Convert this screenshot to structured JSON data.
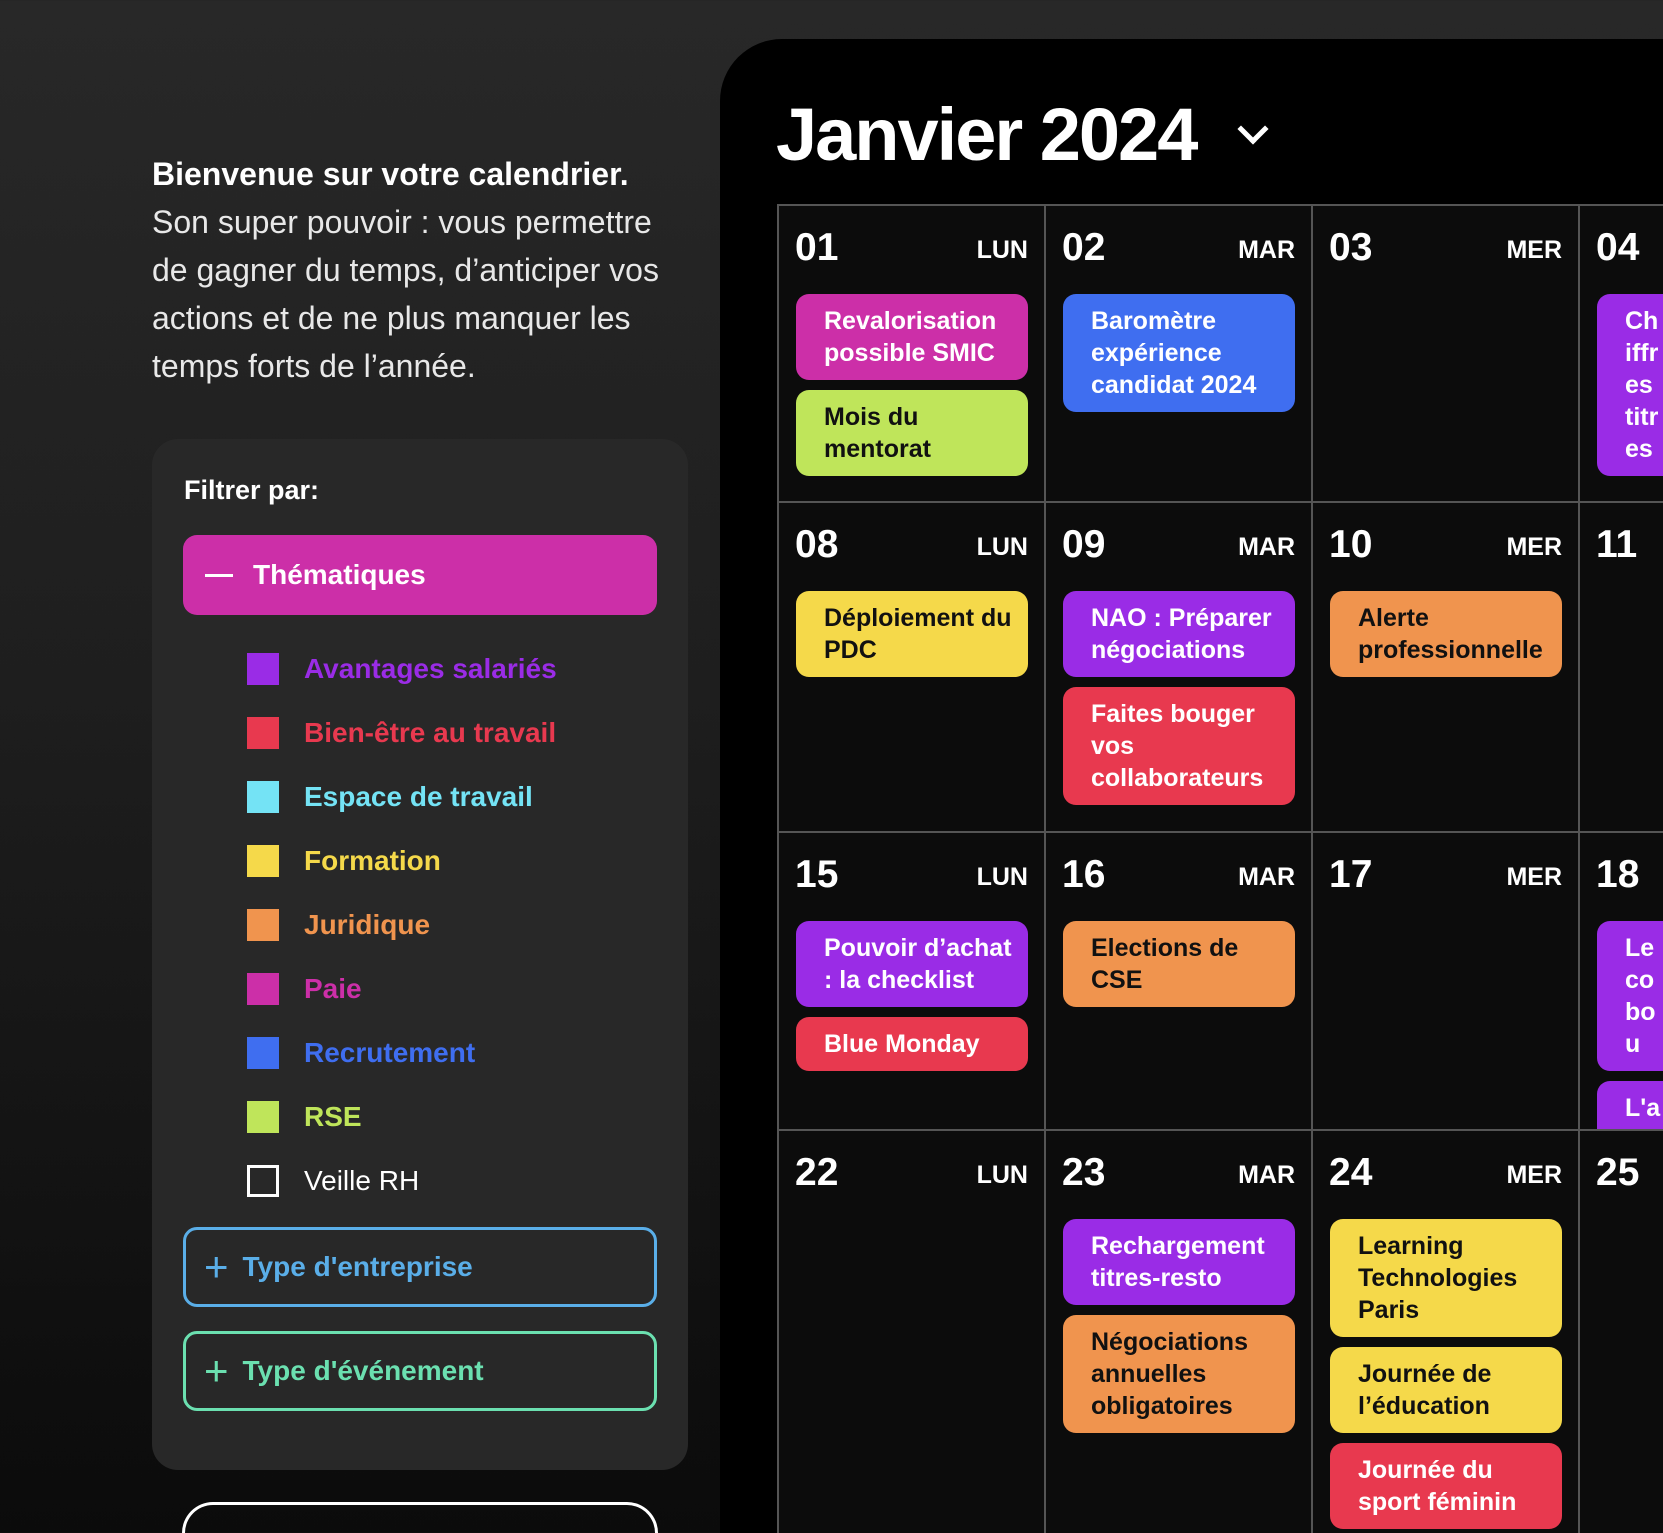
{
  "intro": {
    "title": "Bienvenue sur votre calendrier.",
    "text": "Son super pouvoir : vous permettre de gagner du temps, d’anticiper vos actions et de ne plus manquer les temps forts de l’année."
  },
  "filter": {
    "title": "Filtrer par:",
    "thematiques": "Thématiques",
    "categories": [
      {
        "label": "Avantages salariés",
        "color": "#9a2ce6"
      },
      {
        "label": "Bien-être au travail",
        "color": "#e8394f"
      },
      {
        "label": "Espace de travail",
        "color": "#74e3f5"
      },
      {
        "label": "Formation",
        "color": "#f5d94a"
      },
      {
        "label": "Juridique",
        "color": "#f0944e"
      },
      {
        "label": "Paie",
        "color": "#cc2fa8"
      },
      {
        "label": "Recrutement",
        "color": "#3f6ef0"
      },
      {
        "label": "RSE",
        "color": "#bfe55a"
      },
      {
        "label": "Veille RH",
        "color": "outline"
      }
    ],
    "type_entreprise": "Type d'entreprise",
    "type_evenement": "Type d'événement"
  },
  "calendar": {
    "month": "Janvier 2024",
    "weeks": [
      [
        {
          "day": "01",
          "label": "LUN",
          "events": [
            {
              "t": "Revalorisation possible SMIC",
              "c": "#cc2fa8"
            },
            {
              "t": "Mois du mentorat",
              "c": "#bfe55a",
              "dark": true
            }
          ]
        },
        {
          "day": "02",
          "label": "MAR",
          "events": [
            {
              "t": "Baromètre expérience candidat 2024",
              "c": "#3f6ef0"
            }
          ]
        },
        {
          "day": "03",
          "label": "MER",
          "events": []
        },
        {
          "day": "04",
          "label": "",
          "events": [
            {
              "t": "Chiffres titres",
              "c": "#9a2ce6"
            }
          ]
        }
      ],
      [
        {
          "day": "08",
          "label": "LUN",
          "events": [
            {
              "t": "Déploiement du PDC",
              "c": "#f5d94a",
              "dark": true
            }
          ]
        },
        {
          "day": "09",
          "label": "MAR",
          "events": [
            {
              "t": "NAO : Préparer négociations",
              "c": "#9a2ce6"
            },
            {
              "t": "Faites bouger vos collaborateurs",
              "c": "#e8394f"
            }
          ]
        },
        {
          "day": "10",
          "label": "MER",
          "events": [
            {
              "t": "Alerte professionnelle",
              "c": "#f0944e",
              "dark": true
            }
          ]
        },
        {
          "day": "11",
          "label": "",
          "events": []
        }
      ],
      [
        {
          "day": "15",
          "label": "LUN",
          "events": [
            {
              "t": "Pouvoir d’achat : la checklist",
              "c": "#9a2ce6"
            },
            {
              "t": "Blue Monday",
              "c": "#e8394f"
            }
          ]
        },
        {
          "day": "16",
          "label": "MAR",
          "events": [
            {
              "t": "Elections de CSE",
              "c": "#f0944e",
              "dark": true
            }
          ]
        },
        {
          "day": "17",
          "label": "MER",
          "events": []
        },
        {
          "day": "18",
          "label": "",
          "events": [
            {
              "t": "Le co bou",
              "c": "#9a2ce6"
            },
            {
              "t": "L'ac",
              "c": "#9a2ce6"
            }
          ]
        }
      ],
      [
        {
          "day": "22",
          "label": "LUN",
          "events": []
        },
        {
          "day": "23",
          "label": "MAR",
          "events": [
            {
              "t": "Rechargement titres-resto",
              "c": "#9a2ce6"
            },
            {
              "t": "Négociations annuelles obligatoires",
              "c": "#f0944e",
              "dark": true
            }
          ]
        },
        {
          "day": "24",
          "label": "MER",
          "events": [
            {
              "t": "Learning Technologies Paris",
              "c": "#f5d94a",
              "dark": true
            },
            {
              "t": "Journée de l’éducation",
              "c": "#f5d94a",
              "dark": true
            },
            {
              "t": "Journée du sport féminin",
              "c": "#e8394f"
            }
          ]
        },
        {
          "day": "25",
          "label": "",
          "events": []
        }
      ]
    ]
  }
}
